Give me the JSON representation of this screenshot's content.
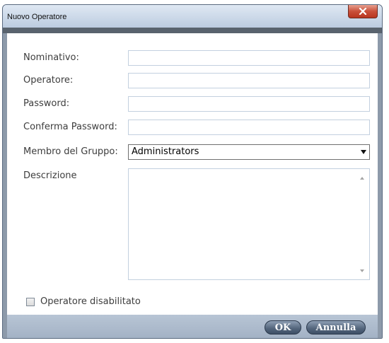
{
  "window": {
    "title": "Nuovo Operatore"
  },
  "form": {
    "nominativo": {
      "label": "Nominativo:",
      "value": ""
    },
    "operatore": {
      "label": "Operatore:",
      "value": ""
    },
    "password": {
      "label": "Password:",
      "value": ""
    },
    "conferma_password": {
      "label": "Conferma Password:",
      "value": ""
    },
    "membro_gruppo": {
      "label": "Membro del Gruppo:",
      "value": "Administrators"
    },
    "descrizione": {
      "label": "Descrizione",
      "value": ""
    },
    "disabled_checkbox": {
      "label": "Operatore disabilitato",
      "checked": false
    }
  },
  "buttons": {
    "ok": "OK",
    "annulla": "Annulla"
  },
  "icons": {
    "close": "close-icon",
    "dropdown": "chevron-down-icon"
  },
  "colors": {
    "close_button": "#c9503a",
    "button_face": "#52647b",
    "footer": "#b8c5d5"
  }
}
